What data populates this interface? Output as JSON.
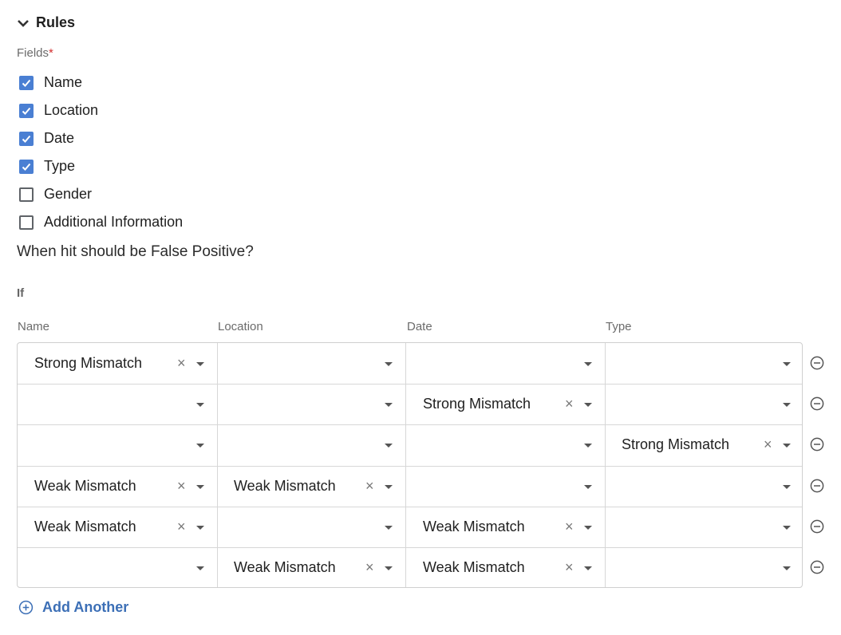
{
  "section": {
    "title": "Rules"
  },
  "fields": {
    "label": "Fields",
    "required_marker": "*",
    "options": [
      {
        "label": "Name",
        "checked": true
      },
      {
        "label": "Location",
        "checked": true
      },
      {
        "label": "Date",
        "checked": true
      },
      {
        "label": "Type",
        "checked": true
      },
      {
        "label": "Gender",
        "checked": false
      },
      {
        "label": "Additional Information",
        "checked": false
      }
    ]
  },
  "question": "When hit should be False Positive?",
  "if_label": "If",
  "columns": [
    "Name",
    "Location",
    "Date",
    "Type"
  ],
  "rules": [
    [
      "Strong Mismatch",
      "",
      "",
      ""
    ],
    [
      "",
      "",
      "Strong Mismatch",
      ""
    ],
    [
      "",
      "",
      "",
      "Strong Mismatch"
    ],
    [
      "Weak Mismatch",
      "Weak Mismatch",
      "",
      ""
    ],
    [
      "Weak Mismatch",
      "",
      "Weak Mismatch",
      ""
    ],
    [
      "",
      "Weak Mismatch",
      "Weak Mismatch",
      ""
    ]
  ],
  "add_another_label": "Add Another",
  "colors": {
    "accent": "#4a7fd3",
    "link": "#3c6fb6",
    "required": "#d32f2f"
  },
  "icons": {
    "collapse": "chevron-down-icon",
    "check": "check-icon",
    "remove": "minus-circle-icon",
    "add": "plus-circle-icon",
    "clear": "clear-x-icon",
    "dropdown": "caret-down-icon"
  }
}
